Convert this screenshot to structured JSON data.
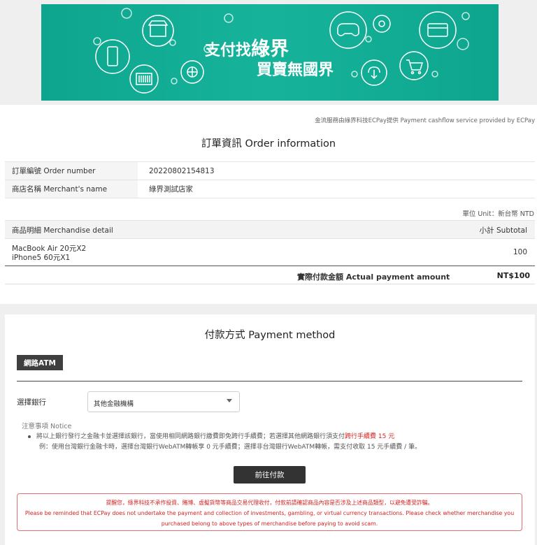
{
  "banner": {
    "title_prefix": "支付找",
    "title_brand": "綠界",
    "subtitle": "買賣無國界",
    "icons": [
      "store-icon",
      "mobile-phone-icon",
      "barcode-icon",
      "globe-icon",
      "gamepad-icon",
      "credit-card-icon",
      "cloud-download-icon",
      "shopping-cart-icon"
    ]
  },
  "order": {
    "cashflow_notice": "金流服務由綠界科技ECPay提供 Payment cashflow service provided by ECPay",
    "title": "訂單資訊 Order information",
    "rows": [
      {
        "label": "訂單編號 Order number",
        "value": "20220802154813"
      },
      {
        "label": "商店名稱 Merchant's name",
        "value": "綠界測試店家"
      }
    ],
    "unit": "單位 Unit：新台幣 NTD",
    "merch_header": "商品明細 Merchandise detail",
    "subtotal_header": "小計 Subtotal",
    "items": [
      "MacBook Air 20元X2",
      "iPhone5 60元X1"
    ],
    "items_amount": "100",
    "payment_label": "實際付款金額 Actual payment amount",
    "payment_amount": "NT$100"
  },
  "payment": {
    "title": "付款方式 Payment method",
    "tab_label": "網路ATM",
    "bank_label": "選擇銀行",
    "bank_selected": "其他金融機構",
    "notice_title": "注意事項 Notice",
    "notice_1": "將以上銀行發行之金融卡並選擇該銀行，當使用相同網路銀行繳費即免跨行手續費；若選擇其他網路銀行須支付",
    "notice_1_red": "跨行手續費 15 元",
    "notice_2": "例：使用台灣銀行金融卡時，選擇台灣銀行WebATM轉帳享 0 元手續費；選擇非台灣銀行WebATM轉帳，需支付收取 15 元手續費 / 筆。",
    "submit_label": "前往付款",
    "warning_zh": "提醒您，綠界科技不承作投資、賭博、虛擬貨幣等商品交易代理收付，付款前請確認商品內容是否涉及上述商品類型，以避免遭受詐騙。",
    "warning_en_1": "Please be reminded that ECPay does not undertake the payment and collection of investments, gambling, or virtual currency transactions. Please check whether merchandise you",
    "warning_en_2": "purchased belong to above types of merchandise before paying to avoid scam."
  },
  "colors": {
    "banner": "#14ad95",
    "accent_red": "#d62020",
    "dark_button": "#333333"
  }
}
